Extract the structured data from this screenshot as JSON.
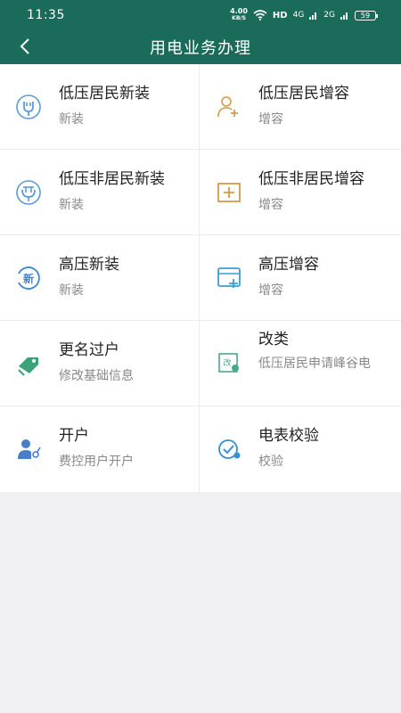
{
  "status": {
    "time": "11:35",
    "speed_value": "4.00",
    "speed_unit": "KB/S",
    "hd": "HD",
    "sig1": "4G",
    "sig2": "2G",
    "battery": "59"
  },
  "header": {
    "title": "用电业务办理"
  },
  "items": [
    {
      "name": "低压居民新装",
      "sub": "新装",
      "icon": "plug-icon",
      "color": "#5a9bd5"
    },
    {
      "name": "低压居民增容",
      "sub": "增容",
      "icon": "add-user-icon",
      "color": "#d59a4a"
    },
    {
      "name": "低压非居民新装",
      "sub": "新装",
      "icon": "plug-circle-icon",
      "color": "#5a9bd5"
    },
    {
      "name": "低压非居民增容",
      "sub": "增容",
      "icon": "plus-square-icon",
      "color": "#d59a4a"
    },
    {
      "name": "高压新装",
      "sub": "新装",
      "icon": "new-badge-icon",
      "color": "#3a86d4"
    },
    {
      "name": "高压增容",
      "sub": "增容",
      "icon": "window-plus-icon",
      "color": "#3a9fd0"
    },
    {
      "name": "更名过户",
      "sub": "修改基础信息",
      "icon": "tag-icon",
      "color": "#3aa37a"
    },
    {
      "name": "改类",
      "sub": "低压居民申请峰谷电",
      "icon": "change-type-icon",
      "color": "#4aa88a",
      "badge": "改"
    },
    {
      "name": "开户",
      "sub": "费控用户开户",
      "icon": "user-key-icon",
      "color": "#4a7ec9"
    },
    {
      "name": "电表校验",
      "sub": "校验",
      "icon": "meter-check-icon",
      "color": "#3a8fcf"
    }
  ]
}
